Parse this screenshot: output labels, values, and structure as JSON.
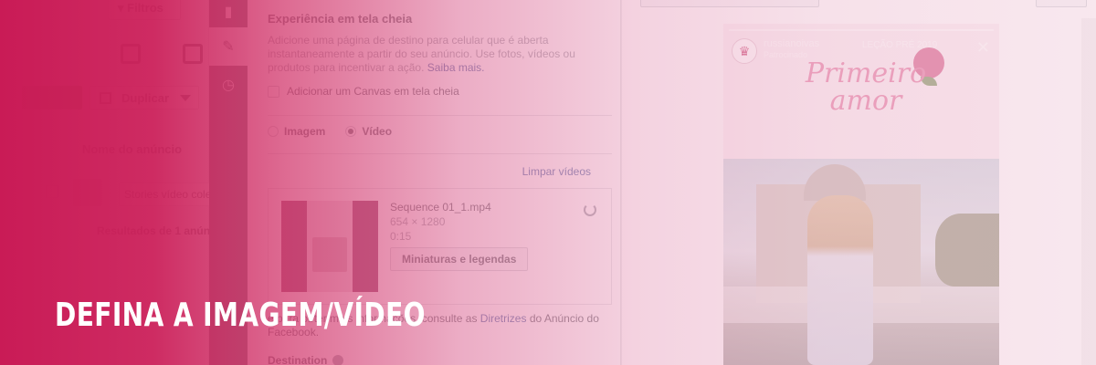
{
  "left_panel": {
    "filter_label": "Filtros",
    "duplicate_label": "Duplicar",
    "column_header": "Nome do anúncio",
    "ad_name": "Stories vídeo coleç",
    "results": "Resultados de 1 anúnc",
    "accent_green": "#42b72a"
  },
  "editor": {
    "section_title": "Experiência em tela cheia",
    "description": "Adicione uma página de destino para celular que é aberta instantaneamente a partir do seu anúncio. Use fotos, vídeos ou produtos para incentivar a ação.",
    "learn_more": "Saiba mais.",
    "canvas_checkbox": "Adicionar um Canvas em tela cheia",
    "media_options": [
      "Imagem",
      "Vídeo"
    ],
    "selected_media": "Vídeo",
    "clear_videos": "Limpar vídeos",
    "video": {
      "filename": "Sequence 01_1.mp4",
      "dimensions": "654 × 1280",
      "duration": "0:15",
      "thumbnails_button": "Miniaturas e legendas"
    },
    "policy_text": "e para obter mais informações, consulte as",
    "policy_link": "Diretrizes",
    "policy_text_2": "do Anúncio do Facebook.",
    "destination_label": "Destination"
  },
  "preview": {
    "brand": "russianoivas",
    "sponsored": "Patrocinado",
    "collection": "LEÇÃO PRÉ 2019",
    "script_title": "Primeiro amor",
    "close_icon": "close-icon"
  },
  "overlay": {
    "headline": "DEFINA A IMAGEM/VÍDEO",
    "gradient_start": "#c91b56",
    "gradient_end": "#f2d2df"
  }
}
